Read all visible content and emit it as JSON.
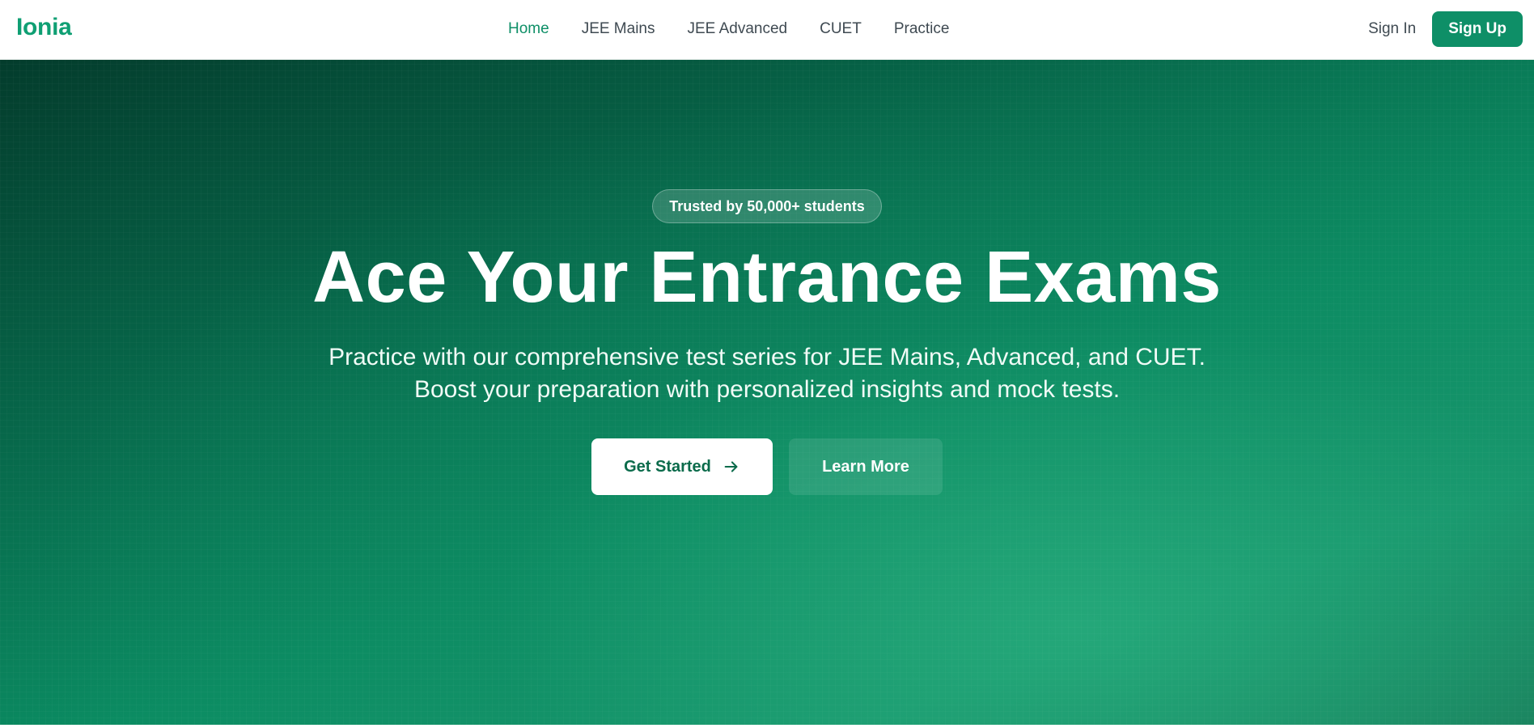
{
  "brand": {
    "name": "Ionia",
    "color": "#0f9f73"
  },
  "nav": {
    "items": [
      {
        "label": "Home",
        "active": true
      },
      {
        "label": "JEE Mains",
        "active": false
      },
      {
        "label": "JEE Advanced",
        "active": false
      },
      {
        "label": "CUET",
        "active": false
      },
      {
        "label": "Practice",
        "active": false
      }
    ],
    "active_color": "#0e8f67"
  },
  "auth": {
    "sign_in_label": "Sign In",
    "sign_up_label": "Sign Up"
  },
  "hero": {
    "badge": "Trusted by 50,000+ students",
    "title": "Ace Your Entrance Exams",
    "subtitle_line1": "Practice with our comprehensive test series for JEE Mains, Advanced, and CUET.",
    "subtitle_line2": "Boost your preparation with personalized insights and mock tests.",
    "primary_cta": "Get Started",
    "primary_cta_icon": "arrow-right-icon",
    "secondary_cta": "Learn More",
    "gradient_colors": [
      "#033c2c",
      "#07694b",
      "#0b8c62",
      "#1a9b70"
    ]
  }
}
